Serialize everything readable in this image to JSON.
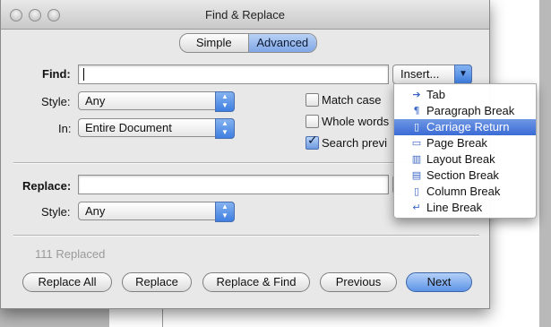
{
  "window": {
    "title": "Find & Replace"
  },
  "mode_tabs": [
    {
      "label": "Simple",
      "selected": false
    },
    {
      "label": "Advanced",
      "selected": true
    }
  ],
  "find": {
    "label": "Find:",
    "value": "",
    "insert_button": "Insert...",
    "style_label": "Style:",
    "style_value": "Any",
    "in_label": "In:",
    "in_value": "Entire Document"
  },
  "options": [
    {
      "label": "Match case",
      "checked": false
    },
    {
      "label": "Whole words",
      "checked": false
    },
    {
      "label": "Search previ",
      "checked": true
    }
  ],
  "replace": {
    "label": "Replace:",
    "value": "",
    "style_label": "Style:",
    "style_value": "Any"
  },
  "status": "111 Replaced",
  "buttons": {
    "replace_all": "Replace All",
    "replace": "Replace",
    "replace_find": "Replace & Find",
    "previous": "Previous",
    "next": "Next"
  },
  "insert_menu": [
    {
      "label": "Tab",
      "icon": "arrow-right-icon",
      "highlighted": false
    },
    {
      "label": "Paragraph Break",
      "icon": "pilcrow-icon",
      "highlighted": false
    },
    {
      "label": "Carriage Return",
      "icon": "carriage-return-icon",
      "highlighted": true
    },
    {
      "label": "Page Break",
      "icon": "page-break-icon",
      "highlighted": false
    },
    {
      "label": "Layout Break",
      "icon": "layout-break-icon",
      "highlighted": false
    },
    {
      "label": "Section Break",
      "icon": "section-break-icon",
      "highlighted": false
    },
    {
      "label": "Column Break",
      "icon": "column-break-icon",
      "highlighted": false
    },
    {
      "label": "Line Break",
      "icon": "line-break-icon",
      "highlighted": false
    }
  ],
  "colors": {
    "accent": "#3b6bd6",
    "default_button": "#5d93e6"
  }
}
